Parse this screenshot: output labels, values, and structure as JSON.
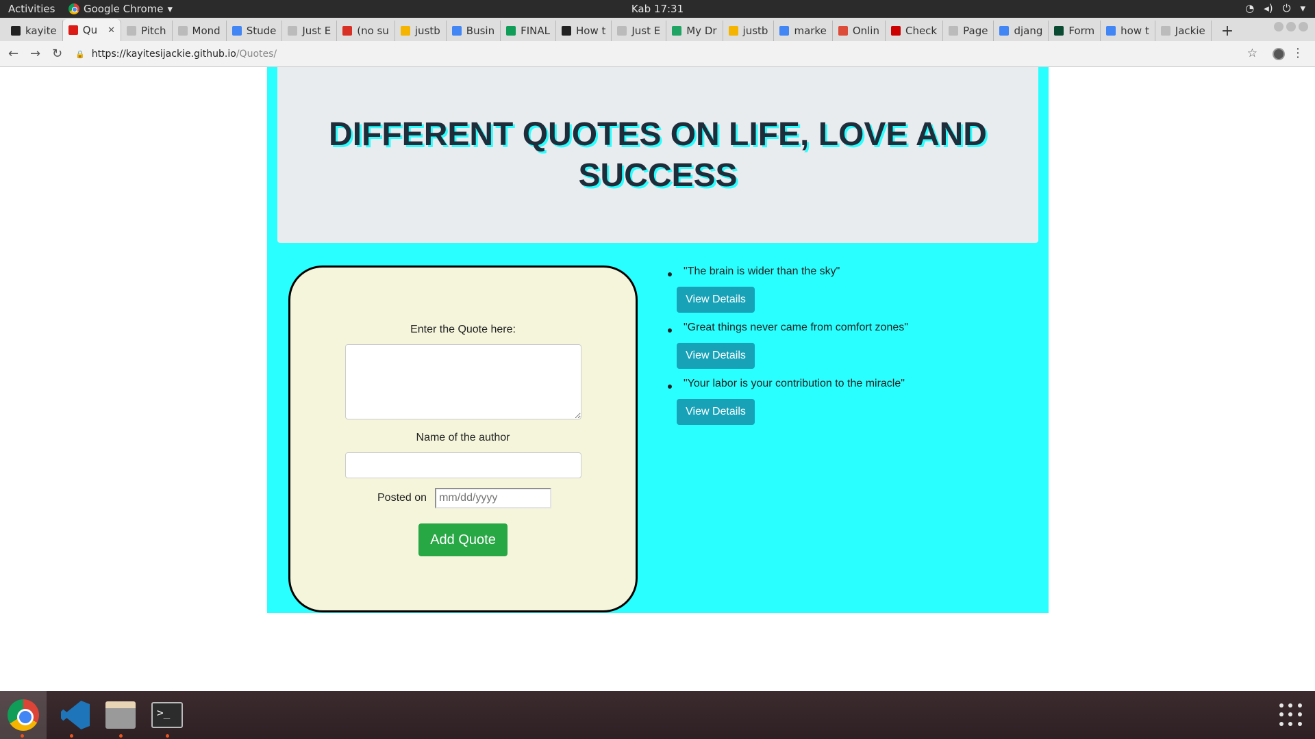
{
  "system": {
    "activities": "Activities",
    "app_name": "Google Chrome",
    "clock": "Kab 17:31"
  },
  "browser": {
    "tabs": [
      {
        "label": "kayite",
        "icon": "github-icon",
        "color": "#222222"
      },
      {
        "label": "Qu",
        "icon": "angular-icon",
        "color": "#dd1b16",
        "active": true
      },
      {
        "label": "Pitch",
        "icon": "page-icon",
        "color": "#bbbbbb"
      },
      {
        "label": "Mond",
        "icon": "page-icon",
        "color": "#bbbbbb"
      },
      {
        "label": "Stude",
        "icon": "docs-icon",
        "color": "#4285f4"
      },
      {
        "label": "Just E",
        "icon": "page-icon",
        "color": "#bbbbbb"
      },
      {
        "label": "(no su",
        "icon": "gmail-icon",
        "color": "#d93025"
      },
      {
        "label": "justb",
        "icon": "slides-icon",
        "color": "#f4b400"
      },
      {
        "label": "Busin",
        "icon": "docs-icon",
        "color": "#4285f4"
      },
      {
        "label": "FINAL",
        "icon": "sheets-icon",
        "color": "#0f9d58"
      },
      {
        "label": "How t",
        "icon": "hbr-icon",
        "color": "#222222"
      },
      {
        "label": "Just E",
        "icon": "page-icon",
        "color": "#bbbbbb"
      },
      {
        "label": "My Dr",
        "icon": "drive-icon",
        "color": "#1fa463"
      },
      {
        "label": "justb",
        "icon": "slides-icon",
        "color": "#f4b400"
      },
      {
        "label": "marke",
        "icon": "google-icon",
        "color": "#4285f4"
      },
      {
        "label": "Onlin",
        "icon": "calendar-icon",
        "color": "#dd4b39"
      },
      {
        "label": "Check",
        "icon": "check-icon",
        "color": "#cc0000"
      },
      {
        "label": "Page",
        "icon": "page-icon",
        "color": "#bbbbbb"
      },
      {
        "label": "djang",
        "icon": "google-icon",
        "color": "#4285f4"
      },
      {
        "label": "Form",
        "icon": "django-icon",
        "color": "#0c4b33"
      },
      {
        "label": "how t",
        "icon": "google-icon",
        "color": "#4285f4"
      },
      {
        "label": "Jackie",
        "icon": "page-icon",
        "color": "#bbbbbb"
      }
    ],
    "url_host": "https://kayitesijackie.github.io",
    "url_path": "/Quotes/"
  },
  "page": {
    "title": "DIFFERENT QUOTES ON LIFE, LOVE AND SUCCESS",
    "form": {
      "quote_label": "Enter the Quote here:",
      "quote_value": "",
      "author_label": "Name of the author",
      "author_value": "",
      "posted_label": "Posted on",
      "date_placeholder": "mm/dd/yyyy",
      "submit_label": "Add Quote"
    },
    "quotes": [
      {
        "text": "\"The brain is wider than the sky\"",
        "button": "View Details"
      },
      {
        "text": "\"Great things never came from comfort zones\"",
        "button": "View Details"
      },
      {
        "text": "\"Your labor is your contribution to the miracle\"",
        "button": "View Details"
      }
    ]
  },
  "colors": {
    "container_bg": "#2affff",
    "jumbotron_bg": "#e9ecef",
    "form_card_bg": "#f5f5dc",
    "add_button": "#28a745",
    "view_button": "#17a2b8"
  },
  "dock": {
    "apps": [
      {
        "name": "chrome-icon",
        "running": true,
        "active": true
      },
      {
        "name": "vscode-icon",
        "running": true
      },
      {
        "name": "files-icon",
        "running": true
      },
      {
        "name": "terminal-icon",
        "running": true
      }
    ]
  }
}
